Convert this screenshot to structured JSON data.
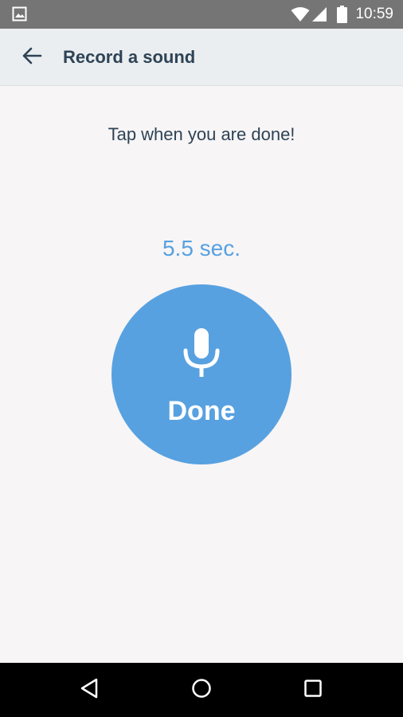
{
  "status_bar": {
    "time": "10:59",
    "icons": [
      "image-notification-icon",
      "wifi-icon",
      "cell-signal-icon",
      "battery-icon"
    ]
  },
  "toolbar": {
    "back_icon": "arrow-left-icon",
    "title": "Record a sound"
  },
  "main": {
    "instruction": "Tap when you are done!",
    "timer": "5.5 sec.",
    "done_button": {
      "icon": "microphone-icon",
      "label": "Done"
    }
  },
  "nav_bar": {
    "buttons": [
      "back-triangle-icon",
      "home-circle-icon",
      "recents-square-icon"
    ]
  },
  "colors": {
    "accent": "#58a1e0",
    "text_dark": "#2e4356",
    "background": "#f7f5f6",
    "toolbar_bg": "#ebeef0",
    "status_bar_bg": "#757575"
  }
}
